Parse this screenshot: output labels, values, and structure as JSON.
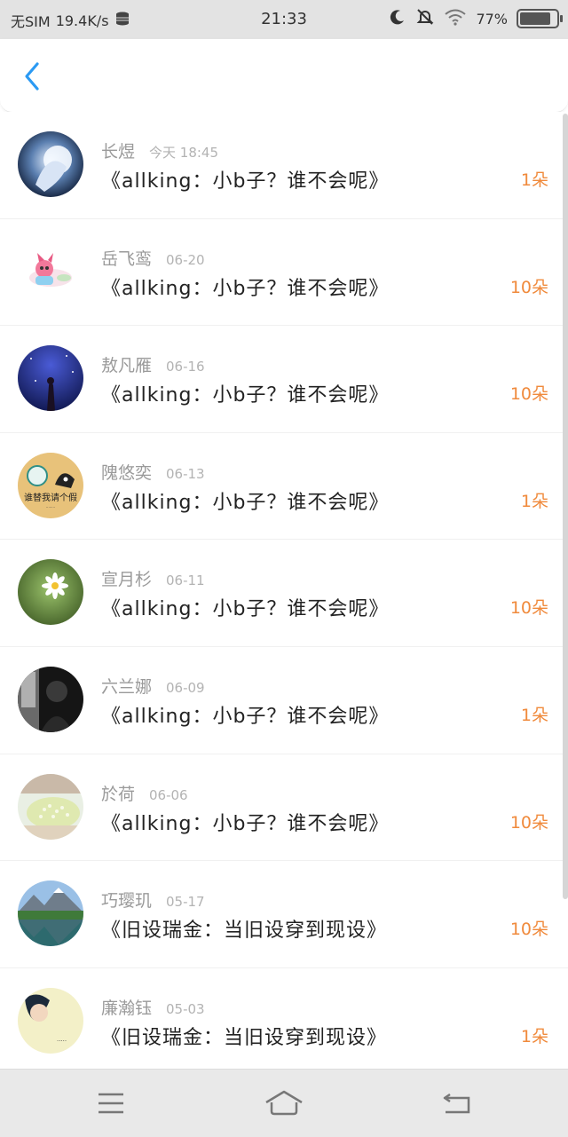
{
  "status_bar": {
    "sim": "无SIM",
    "speed": "19.4K/s",
    "time": "21:33",
    "battery": "77%"
  },
  "list": [
    {
      "name": "长煜",
      "date": "今天 18:45",
      "title": "《allking：小b子？谁不会呢》",
      "amount": "1朵",
      "avatar": "anime-girl"
    },
    {
      "name": "岳飞鸾",
      "date": "06-20",
      "title": "《allking：小b子？谁不会呢》",
      "amount": "10朵",
      "avatar": "pink-cartoon"
    },
    {
      "name": "敖凡雁",
      "date": "06-16",
      "title": "《allking：小b子？谁不会呢》",
      "amount": "10朵",
      "avatar": "starry-night"
    },
    {
      "name": "隗悠奕",
      "date": "06-13",
      "title": "《allking：小b子？谁不会呢》",
      "amount": "1朵",
      "avatar": "cartoon-cat"
    },
    {
      "name": "宣月杉",
      "date": "06-11",
      "title": "《allking：小b子？谁不会呢》",
      "amount": "10朵",
      "avatar": "daisy"
    },
    {
      "name": "六兰娜",
      "date": "06-09",
      "title": "《allking：小b子？谁不会呢》",
      "amount": "1朵",
      "avatar": "bw-portrait"
    },
    {
      "name": "於荷",
      "date": "06-06",
      "title": "《allking：小b子？谁不会呢》",
      "amount": "10朵",
      "avatar": "flowers"
    },
    {
      "name": "巧璎玑",
      "date": "05-17",
      "title": "《旧设瑞金：当旧设穿到现设》",
      "amount": "10朵",
      "avatar": "mountain-lake"
    },
    {
      "name": "廉瀚钰",
      "date": "05-03",
      "title": "《旧设瑞金：当旧设穿到现设》",
      "amount": "1朵",
      "avatar": "face-drawing"
    }
  ],
  "icons": {
    "back": "chevron-left-icon",
    "menu": "menu-icon",
    "home": "home-icon",
    "return": "return-icon"
  },
  "colors": {
    "accent": "#2b9af3",
    "amount": "#f08a3c"
  }
}
